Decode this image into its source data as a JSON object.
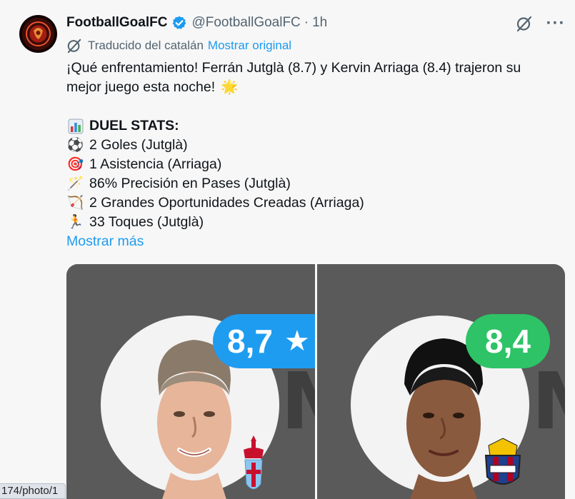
{
  "account": {
    "name": "FootballGoalFC",
    "handle": "@FootballGoalFC",
    "separator": "·",
    "time": "1h"
  },
  "translation": {
    "note": "Traducido del catalán",
    "show_original": "Mostrar original"
  },
  "post": {
    "line1": "¡Qué enfrentamiento! Ferrán Jutglà (8.7) y Kervin Arriaga (8.4) trajeron su",
    "line2": "mejor juego esta noche!",
    "line2_emoji": "🌟",
    "stats_heading": "DUEL STATS:",
    "stats": [
      {
        "icon": "soccer-ball-icon",
        "glyph": "⚽",
        "text": "2 Goles (Jutglà)"
      },
      {
        "icon": "target-icon",
        "glyph": "🎯",
        "text": "1 Asistencia (Arriaga)"
      },
      {
        "icon": "magic-wand-icon",
        "glyph": "🪄",
        "text": "86% Precisión en Pases (Jutglà)"
      },
      {
        "icon": "bow-arrow-icon",
        "glyph": "🏹",
        "text": "2 Grandes Oportunidades Creadas (Arriaga)"
      },
      {
        "icon": "running-person-icon",
        "glyph": "🏃",
        "text": "33 Toques (Jutglà)"
      }
    ],
    "show_more": "Mostrar más"
  },
  "media": {
    "left": {
      "rating": "8,7",
      "rating_color": "#1e9cf0",
      "background_letter": "M"
    },
    "right": {
      "rating": "8,4",
      "rating_color": "#2ec366",
      "background_letter": "M"
    }
  },
  "status_bar": {
    "url_fragment": "174/photo/1"
  },
  "colors": {
    "link": "#1d9bf0",
    "verified": "#1d9bf0",
    "secondary_text": "#536471"
  }
}
